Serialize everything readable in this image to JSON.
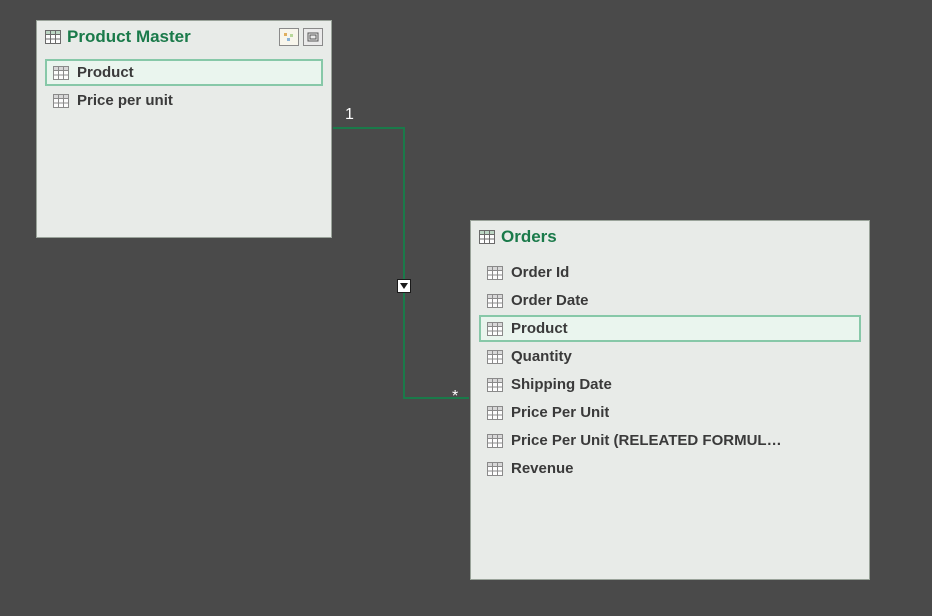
{
  "entities": {
    "product_master": {
      "title": "Product Master",
      "fields": [
        {
          "label": "Product",
          "selected": true
        },
        {
          "label": "Price per unit",
          "selected": false
        }
      ]
    },
    "orders": {
      "title": "Orders",
      "fields": [
        {
          "label": "Order Id",
          "selected": false
        },
        {
          "label": "Order Date",
          "selected": false
        },
        {
          "label": "Product",
          "selected": true
        },
        {
          "label": "Quantity",
          "selected": false
        },
        {
          "label": "Shipping Date",
          "selected": false
        },
        {
          "label": "Price Per Unit",
          "selected": false
        },
        {
          "label": "Price Per Unit (RELEATED FORMUL…",
          "selected": false
        },
        {
          "label": "Revenue",
          "selected": false
        }
      ]
    }
  },
  "relationship": {
    "from_cardinality": "1",
    "to_cardinality": "*"
  },
  "colors": {
    "background": "#4a4a4a",
    "entity_bg": "#e8ebe8",
    "title": "#1a7a4a",
    "selected_border": "#87c8a8"
  }
}
